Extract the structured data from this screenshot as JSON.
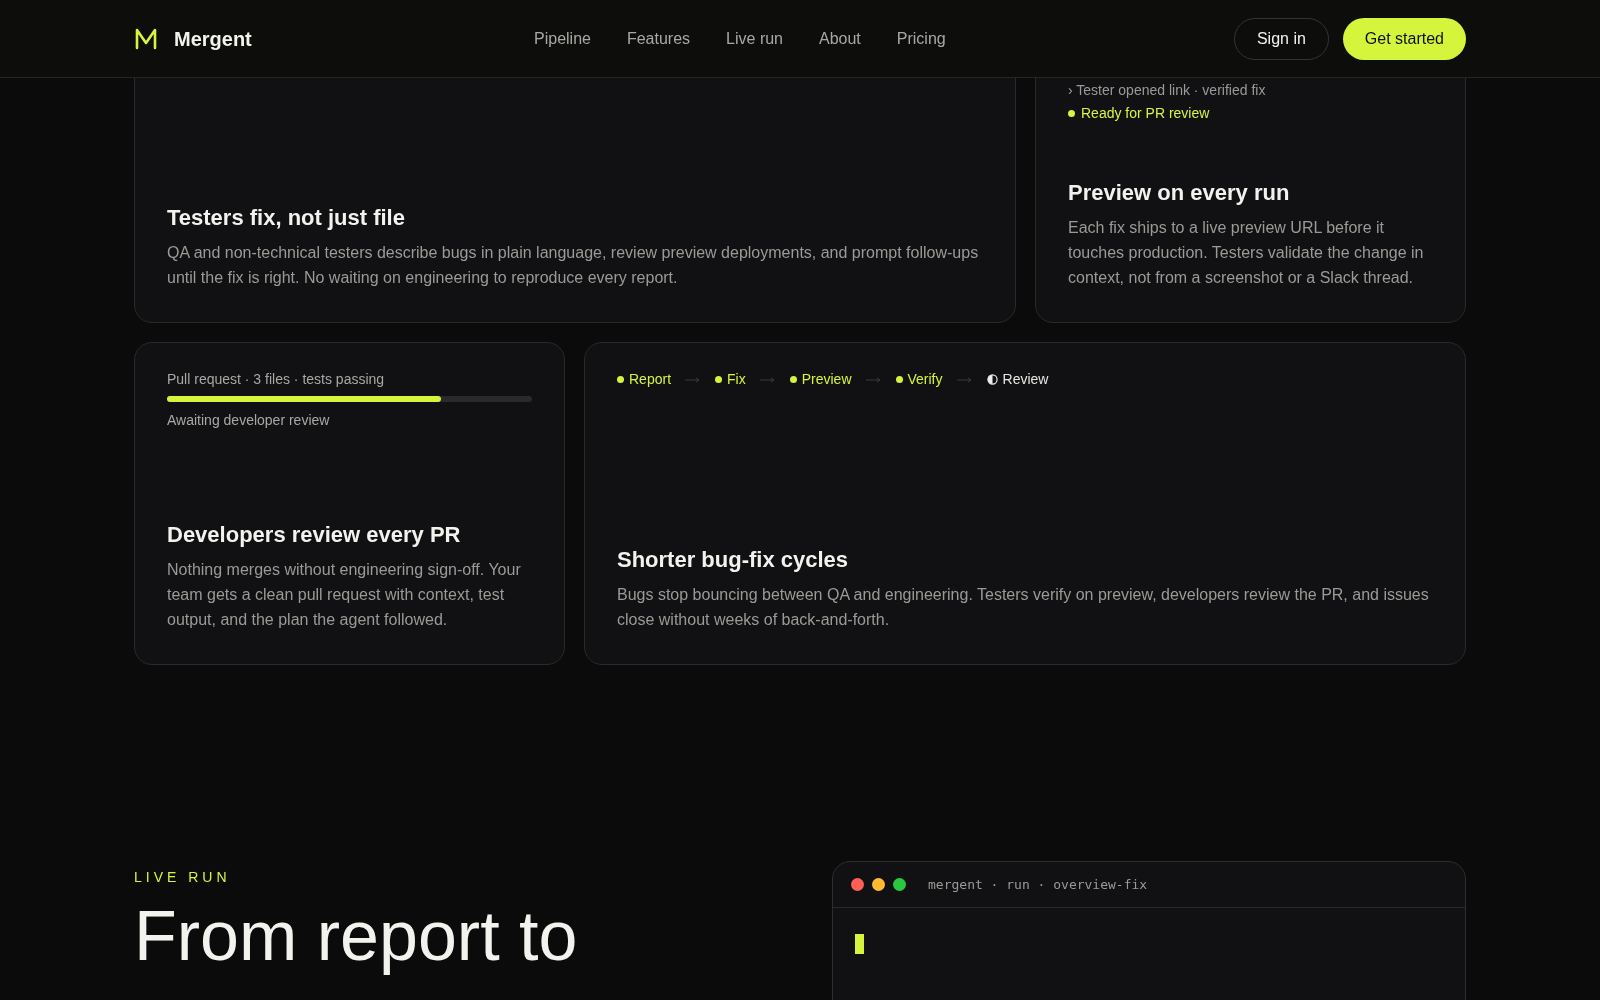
{
  "header": {
    "brand": "Mergent",
    "nav": [
      {
        "label": "Pipeline"
      },
      {
        "label": "Features"
      },
      {
        "label": "Live run"
      },
      {
        "label": "About"
      },
      {
        "label": "Pricing"
      }
    ],
    "sign_in": "Sign in",
    "cta": "Get started"
  },
  "cards": [
    {
      "kind": "plain",
      "title": "Testers fix, not just file",
      "body": "QA and non-technical testers describe bugs in plain language, review preview deployments, and prompt follow-ups until the fix is right. No waiting on engineering to reproduce every report."
    },
    {
      "kind": "log",
      "log": [
        "› Tester opened link · verified fix"
      ],
      "status": "Ready for PR review",
      "title": "Preview on every run",
      "body": "Each fix ships to a live preview URL before it touches production. Testers validate the change in context, not from a screenshot or a Slack thread."
    },
    {
      "kind": "progress",
      "caption": "Pull request · 3 files · tests passing",
      "level": 0.75,
      "note": "Awaiting developer review",
      "title": "Developers review every PR",
      "body": "Nothing merges without engineering sign-off. Your team gets a clean pull request with context, test output, and the plan the agent followed."
    },
    {
      "kind": "steps",
      "steps": [
        {
          "label": "Report",
          "done": true
        },
        {
          "label": "Fix",
          "done": true
        },
        {
          "label": "Preview",
          "done": true
        },
        {
          "label": "Verify",
          "done": true
        },
        {
          "label": "Review",
          "done": false
        }
      ],
      "title": "Shorter bug-fix cycles",
      "body": "Bugs stop bouncing between QA and engineering. Testers verify on preview, developers review the PR, and issues close without weeks of back-and-forth."
    }
  ],
  "live": {
    "eyebrow": "LIVE RUN",
    "headline": "From report to",
    "terminal_title": "mergent · run · overview-fix"
  }
}
